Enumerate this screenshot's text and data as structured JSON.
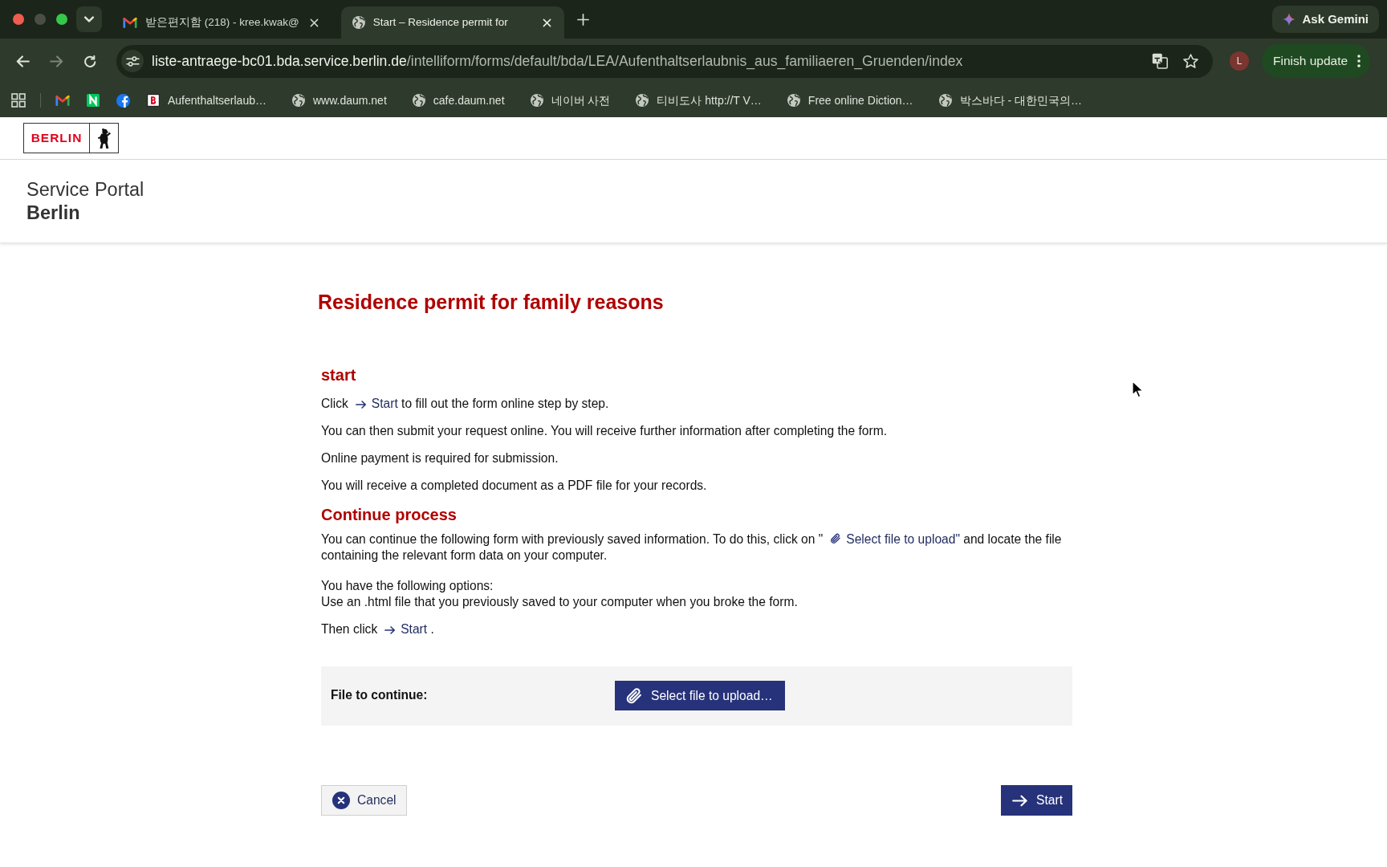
{
  "browser": {
    "tabs": [
      {
        "title": "받은편지함 (218) - kree.kwak@",
        "kind": "mail",
        "selected": false
      },
      {
        "title": "Start – Residence permit for",
        "kind": "globe",
        "selected": true
      }
    ],
    "gemini_button": "Ask Gemini",
    "nav": [
      {
        "kind": "back",
        "disabled": false
      },
      {
        "kind": "forward",
        "disabled": true
      },
      {
        "kind": "reload",
        "disabled": false
      }
    ],
    "address": {
      "host": "liste-antraege-bc01.bda.service.berlin.de",
      "path": "/intelliform/forms/default/bda/LEA/Aufenthaltserlaubnis_aus_familiaeren_Gruenden/index"
    },
    "profile_initial": "L",
    "update_button": "Finish update",
    "bookmarks": [
      {
        "kind": "mail"
      },
      {
        "kind": "tile"
      },
      {
        "kind": "disc"
      },
      {
        "label": "Aufenthaltserlaub…",
        "kind": "badge"
      },
      {
        "label": "www.daum.net",
        "kind": "globe"
      },
      {
        "label": "cafe.daum.net",
        "kind": "globe"
      },
      {
        "label": "네이버 사전",
        "kind": "globe"
      },
      {
        "label": "티비도사 http://T V…",
        "kind": "globe"
      },
      {
        "label": "Free online Diction…",
        "kind": "globe"
      },
      {
        "label": "박스바다 - 대한민국의…",
        "kind": "globe"
      }
    ]
  },
  "page": {
    "logo": "BERLIN",
    "portal": {
      "name": "Service Portal",
      "city": "Berlin"
    },
    "title": "Residence permit for family reasons",
    "sections": [
      {
        "heading": "start",
        "paragraphs": [
          {
            "kind": "arrow",
            "before": "Click",
            "ref": "Start",
            "after": "to fill out the form online step by step."
          },
          {
            "kind": "plain",
            "lines": [
              "You can then submit your request online. You will receive further information after completing the form."
            ]
          },
          {
            "kind": "plain",
            "lines": [
              "Online payment is required for submission."
            ]
          },
          {
            "kind": "plain",
            "lines": [
              "You will receive a completed document as a PDF file for your records."
            ]
          }
        ]
      },
      {
        "heading": "Continue process",
        "paragraphs": [
          {
            "kind": "clip",
            "before": "You can continue the following form with previously saved information. To do this, click on \"",
            "ref": "Select file to upload\"",
            "after": "and locate the file",
            "continuation": "containing the relevant form data on your computer."
          },
          {
            "kind": "plain",
            "lines": [
              "You have the following options:",
              "Use an .html file that you previously saved to your computer when you broke the form."
            ]
          },
          {
            "kind": "arrow",
            "before": "Then click",
            "ref": "Start",
            "after": "."
          }
        ]
      }
    ],
    "upload": {
      "label": "File to continue:",
      "button": "Select file to upload…"
    },
    "actions": {
      "cancel": "Cancel",
      "start": "Start"
    }
  }
}
